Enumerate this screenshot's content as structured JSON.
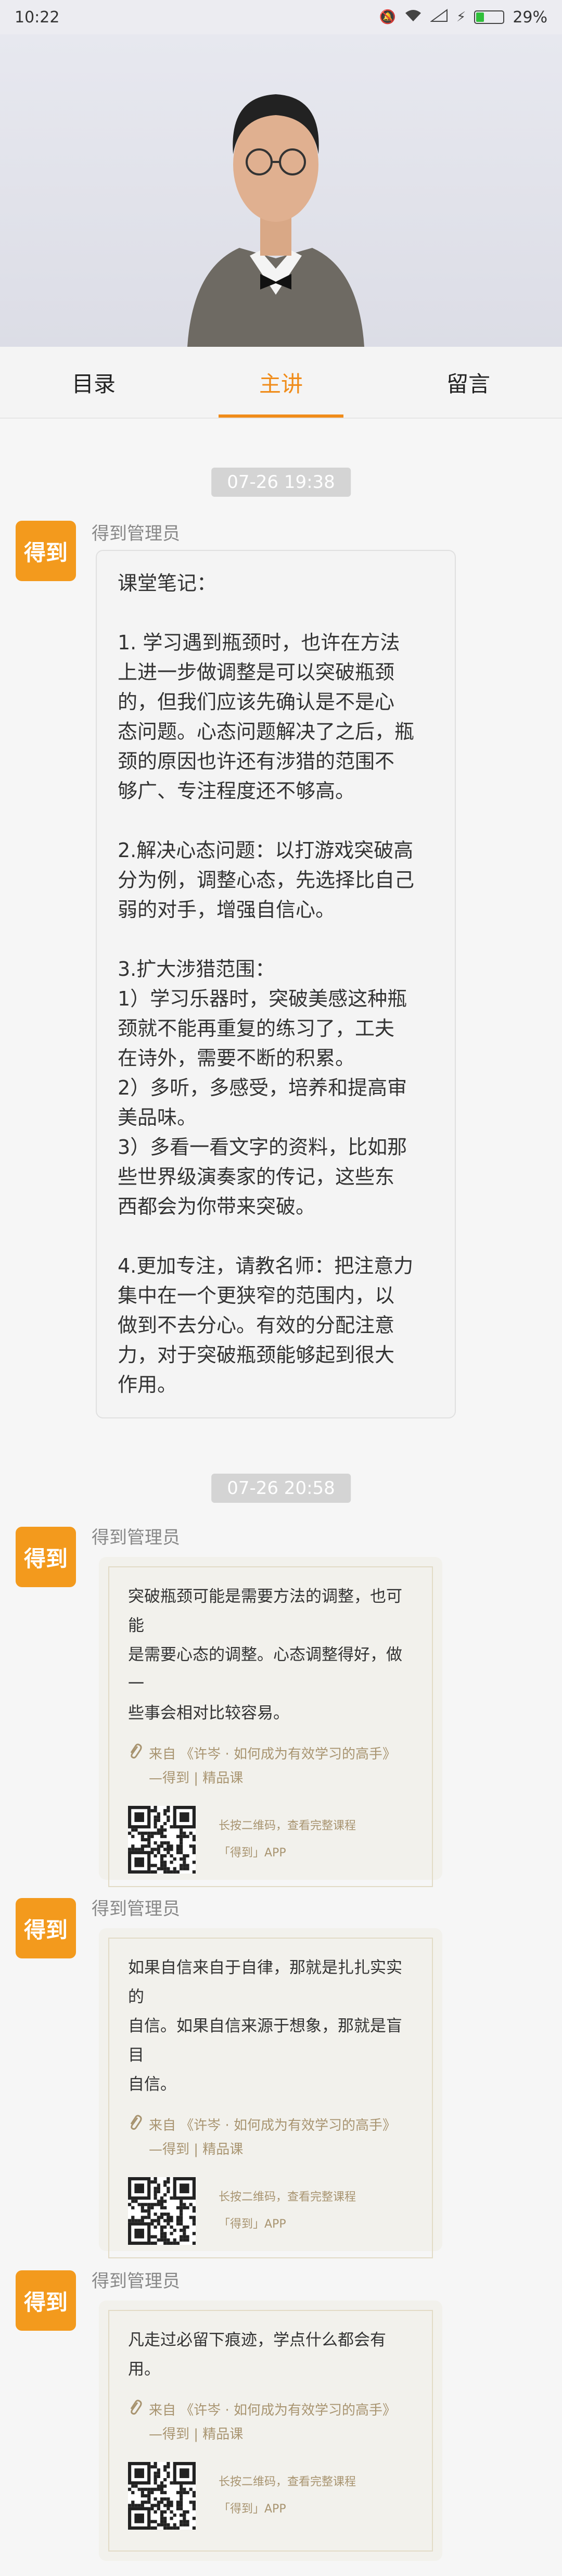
{
  "status": {
    "time": "10:22",
    "battery": "29%",
    "battery_level": 0.29,
    "battery_color": "#2fbf3a"
  },
  "tabs": [
    {
      "label": "目录"
    },
    {
      "label": "主讲"
    },
    {
      "label": "留言"
    }
  ],
  "colors": {
    "accent": "#f08c1a",
    "avatar_bg": "#f39a1d"
  },
  "messages": [
    {
      "time": "07-26 19:38",
      "sender": "得到管理员",
      "avatar": "得到",
      "lines": [
        "课堂笔记：",
        "",
        "1. 学习遇到瓶颈时，也许在方法",
        "上进一步做调整是可以突破瓶颈",
        "的，但我们应该先确认是不是心",
        "态问题。心态问题解决了之后，瓶",
        "颈的原因也许还有涉猎的范围不",
        "够广、专注程度还不够高。",
        "",
        "2.解决心态问题：以打游戏突破高",
        "分为例，调整心态，先选择比自己",
        "弱的对手，增强自信心。",
        "",
        "3.扩大涉猎范围：",
        "1）学习乐器时，突破美感这种瓶",
        "颈就不能再重复的练习了，工夫",
        "在诗外，需要不断的积累。",
        "2）多听，多感受，培养和提高审",
        "美品味。",
        "3）多看一看文字的资料，比如那",
        "些世界级演奏家的传记，这些东",
        "西都会为你带来突破。",
        "",
        "4.更加专注，请教名师：把注意力",
        "集中在一个更狭窄的范围内，以",
        "做到不去分心。有效的分配注意",
        "力，对于突破瓶颈能够起到很大",
        "作用。"
      ]
    },
    {
      "time": "07-26 20:58",
      "sender": "得到管理员",
      "avatar": "得到",
      "quote_lines": [
        "突破瓶颈可能是需要方法的调整，也可能",
        "是需要心态的调整。心态调整得好，做一",
        "些事会相对比较容易。"
      ],
      "source_lines": [
        "来自 《许岑 · 如何成为有效学习的高手》",
        "—得到 | 精品课"
      ],
      "qr_lines": [
        "长按二维码，查看完整课程",
        "「得到」APP"
      ]
    },
    {
      "sender": "得到管理员",
      "avatar": "得到",
      "quote_lines": [
        "如果自信来自于自律，那就是扎扎实实的",
        "自信。如果自信来源于想象，那就是盲目",
        "自信。"
      ],
      "source_lines": [
        "来自 《许岑 · 如何成为有效学习的高手》",
        "—得到 | 精品课"
      ],
      "qr_lines": [
        "长按二维码，查看完整课程",
        "「得到」APP"
      ]
    },
    {
      "sender": "得到管理员",
      "avatar": "得到",
      "quote_lines": [
        "凡走过必留下痕迹，学点什么都会有用。"
      ],
      "source_lines": [
        "来自 《许岑 · 如何成为有效学习的高手》",
        "—得到 | 精品课"
      ],
      "qr_lines": [
        "长按二维码，查看完整课程",
        "「得到」APP"
      ]
    }
  ]
}
